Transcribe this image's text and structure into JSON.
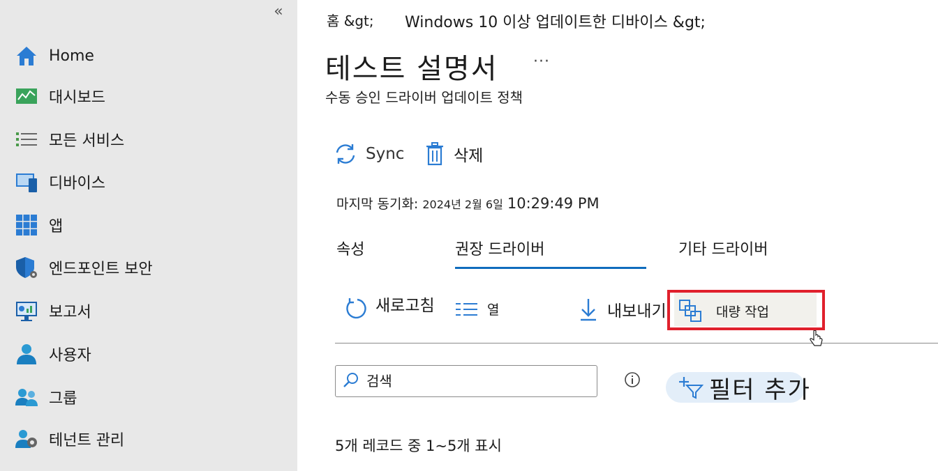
{
  "sidebar": {
    "collapse_label": "«",
    "items": [
      {
        "label": "Home",
        "icon": "home-icon"
      },
      {
        "label": "대시보드",
        "icon": "dashboard-icon"
      },
      {
        "label": "모든 서비스",
        "icon": "list-icon"
      },
      {
        "label": "디바이스",
        "icon": "devices-icon"
      },
      {
        "label": "앱",
        "icon": "apps-grid-icon"
      },
      {
        "label": "엔드포인트 보안",
        "icon": "shield-icon"
      },
      {
        "label": "보고서",
        "icon": "reports-icon"
      },
      {
        "label": "사용자",
        "icon": "user-icon"
      },
      {
        "label": "그룹",
        "icon": "group-icon"
      },
      {
        "label": "테넌트 관리",
        "icon": "tenant-admin-icon"
      }
    ]
  },
  "breadcrumb": {
    "home": "홈 &gt;",
    "parent": "Windows 10 이상 업데이트한 디바이스 &gt;"
  },
  "header": {
    "title": "테스트 설명서",
    "more": "···",
    "subtitle": "수동 승인 드라이버 업데이트 정책"
  },
  "commands": {
    "sync": "Sync",
    "delete": "삭제"
  },
  "last_sync": {
    "label": "마지막 동기화:",
    "value": "2024년 2월 6일",
    "time": "10:29:49 PM"
  },
  "tabs": [
    {
      "label": "속성",
      "selected": false
    },
    {
      "label": "권장 드라이버",
      "selected": true
    },
    {
      "label": "기타 드라이버",
      "selected": false
    }
  ],
  "toolbar": {
    "refresh": "새로고침",
    "columns": "열",
    "export": "내보내기",
    "bulk_actions": "대량 작업"
  },
  "search": {
    "placeholder": "검색",
    "value": ""
  },
  "filter": {
    "add_label": "필터 추가"
  },
  "records": {
    "summary": "5개 레코드 중 1~5개 표시"
  },
  "colors": {
    "accent": "#0f6cbd",
    "highlight": "#e0202c",
    "sidebar_bg": "#e8e8e8",
    "filter_bg": "#e3eef9"
  }
}
